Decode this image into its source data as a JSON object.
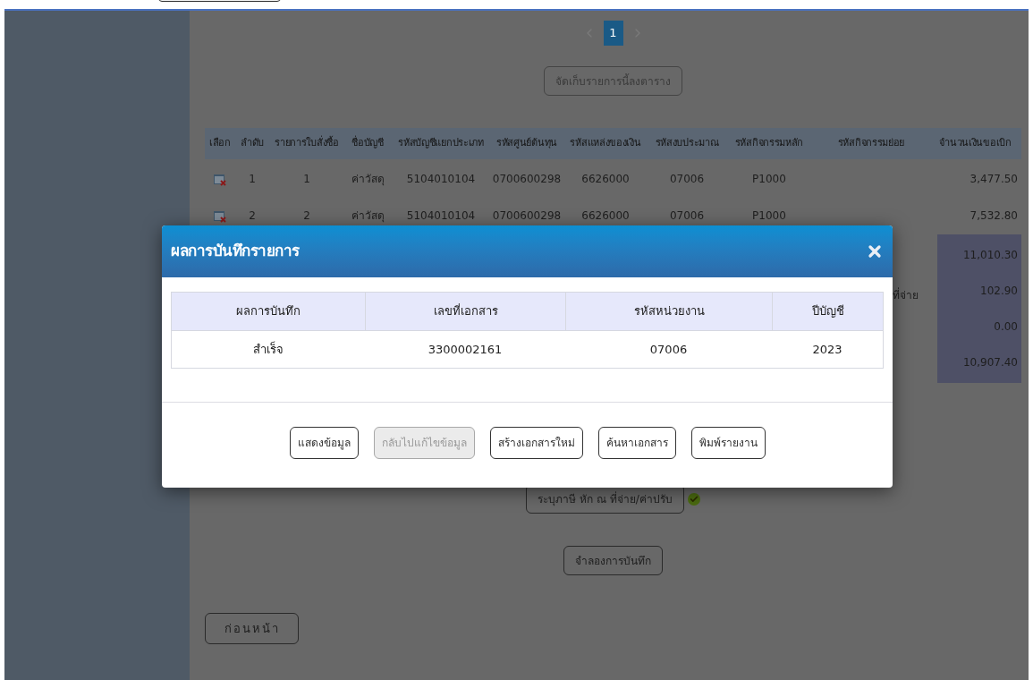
{
  "pagination": {
    "pages": [
      {
        "label": "1",
        "selected": true
      }
    ]
  },
  "save_to_table_button": "จัดเก็บรายการนี้ลงตาราง",
  "items_table": {
    "columns": [
      "เลือก",
      "ลำดับ",
      "รายการใบสั่งซื้อ",
      "ชื่อบัญชี",
      "รหัสบัญชีแยกประเภท",
      "รหัสศูนย์ต้นทุน",
      "รหัสแหล่งของเงิน",
      "รหัสงบประมาณ",
      "รหัสกิจกรรมหลัก",
      "รหัสกิจกรรมย่อย",
      "จำนวนเงินขอเบิก"
    ],
    "rows": [
      {
        "seq": "1",
        "po_item": "1",
        "account_name": "ค่าวัสดุ",
        "gl_account": "5104010104",
        "cost_center": "0700600298",
        "fund_source": "6626000",
        "budget_code": "07006",
        "main_activity": "P1000",
        "amount": "3,477.50"
      },
      {
        "seq": "2",
        "po_item": "2",
        "account_name": "ค่าวัสดุ",
        "gl_account": "5104010104",
        "cost_center": "0700600298",
        "fund_source": "6626000",
        "budget_code": "07006",
        "main_activity": "P1000",
        "amount": "7,532.80"
      }
    ]
  },
  "summary": {
    "label": "ที่จ่าย",
    "values": [
      "11,010.30",
      "102.90",
      "0.00",
      "10,907.40"
    ]
  },
  "tax_button": "ระบุภาษี หัก ณ ที่จ่าย/ค่าปรับ",
  "simulate_button": "จำลองการบันทึก",
  "back_button": "ก่อนหน้า",
  "dialog": {
    "title": "ผลการบันทึกรายการ",
    "columns": [
      "ผลการบันทึก",
      "เลขที่เอกสาร",
      "รหัสหน่วยงาน",
      "ปีบัญชี"
    ],
    "rows": [
      [
        "สำเร็จ",
        "3300002161",
        "07006",
        "2023"
      ]
    ],
    "buttons": [
      {
        "label": "แสดงข้อมูล",
        "disabled": false
      },
      {
        "label": "กลับไปแก้ไขข้อมูล",
        "disabled": true
      },
      {
        "label": "สร้างเอกสารใหม่",
        "disabled": false
      },
      {
        "label": "ค้นหาเอกสาร",
        "disabled": false
      },
      {
        "label": "พิมพ์รายงาน",
        "disabled": false
      }
    ]
  }
}
